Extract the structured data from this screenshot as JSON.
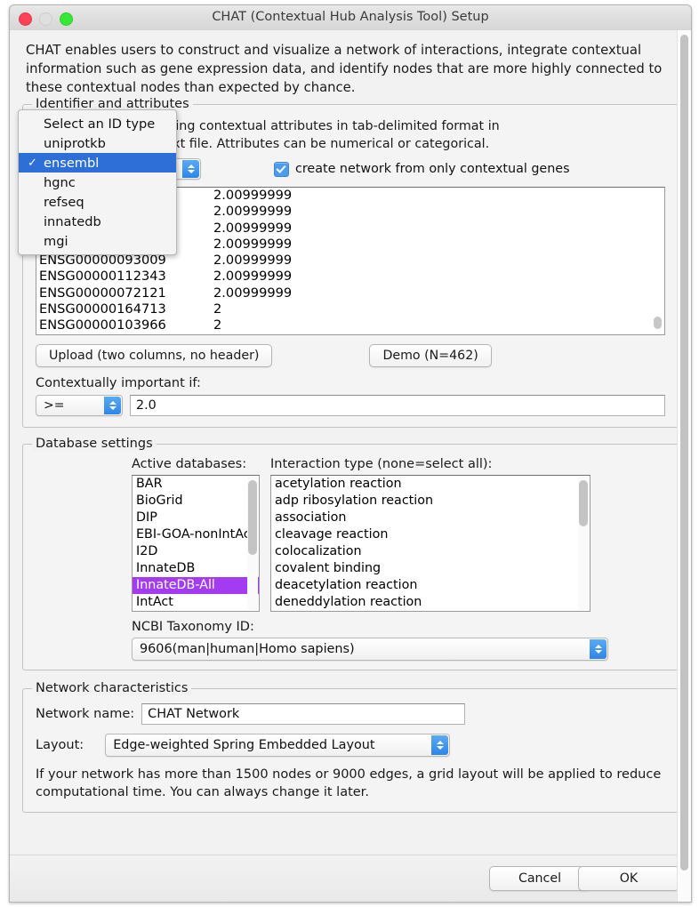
{
  "window": {
    "title": "CHAT (Contextual Hub Analysis Tool) Setup",
    "traffic_lights": [
      "close-button",
      "minimize-button",
      "zoom-button"
    ]
  },
  "intro": "CHAT enables users to construct and visualize a network of interactions, integrate contextual information such as gene expression data, and identify nodes that are more highly connected to these contextual nodes than expected by chance.",
  "identifier_group": {
    "legend": "Identifier and attributes",
    "description_line1": "rs and the corresponding contextual attributes in tab-delimited format in",
    "description_line2": "sv or tab-delimited text file. Attributes can be numerical or categorical.",
    "id_type_value": "ensembl",
    "checkbox": {
      "label": "create network from only contextual genes",
      "checked": true,
      "color": "#4e9bec"
    },
    "gene_table": {
      "rows": [
        {
          "id": "",
          "value": "2.00999999"
        },
        {
          "id": "",
          "value": "2.00999999"
        },
        {
          "id": "",
          "value": "2.00999999"
        },
        {
          "id": "",
          "value": "2.00999999"
        },
        {
          "id": "ENSG00000093009",
          "value": "2.00999999"
        },
        {
          "id": "ENSG00000112343",
          "value": "2.00999999"
        },
        {
          "id": "ENSG00000072121",
          "value": "2.00999999"
        },
        {
          "id": "ENSG00000164713",
          "value": "2"
        },
        {
          "id": "ENSG00000103966",
          "value": "2"
        }
      ]
    },
    "upload_button": "Upload (two columns, no header)",
    "demo_button": "Demo (N=462)",
    "contextually_important_label": "Contextually important if:",
    "operator": ">=",
    "threshold_value": "2.0"
  },
  "id_type_popup": {
    "items": [
      {
        "label": "Select an ID type",
        "selected": false
      },
      {
        "label": "uniprotkb",
        "selected": false
      },
      {
        "label": "ensembl",
        "selected": true
      },
      {
        "label": "hgnc",
        "selected": false
      },
      {
        "label": "refseq",
        "selected": false
      },
      {
        "label": "innatedb",
        "selected": false
      },
      {
        "label": "mgi",
        "selected": false
      }
    ],
    "check_glyph": "✓",
    "highlight_color": "#2d6fd6"
  },
  "database_group": {
    "legend": "Database settings",
    "active_databases_label": "Active databases:",
    "interaction_type_label": "Interaction type (none=select all):",
    "active_databases": [
      {
        "label": "BAR",
        "selected": false
      },
      {
        "label": "BioGrid",
        "selected": false
      },
      {
        "label": "DIP",
        "selected": false
      },
      {
        "label": "EBI-GOA-nonIntAct",
        "selected": false
      },
      {
        "label": "I2D",
        "selected": false
      },
      {
        "label": "InnateDB",
        "selected": false
      },
      {
        "label": "InnateDB-All",
        "selected": true
      },
      {
        "label": "IntAct",
        "selected": false
      }
    ],
    "selected_database_color": "#a33cf0",
    "interaction_types": [
      "acetylation reaction",
      "adp ribosylation reaction",
      "association",
      "cleavage reaction",
      "colocalization",
      "covalent binding",
      "deacetylation reaction",
      "deneddylation reaction"
    ],
    "taxonomy_label": "NCBI Taxonomy ID:",
    "taxonomy_value": "9606(man|human|Homo sapiens)"
  },
  "network_group": {
    "legend": "Network characteristics",
    "network_name_label": "Network name:",
    "network_name_value": "CHAT Network",
    "layout_label": "Layout:",
    "layout_value": "Edge-weighted Spring Embedded Layout",
    "note": "If your network has more than 1500 nodes or 9000 edges, a grid layout will be applied to reduce computational time. You can always change it later."
  },
  "footer": {
    "cancel_label": "Cancel",
    "ok_label": "OK"
  }
}
